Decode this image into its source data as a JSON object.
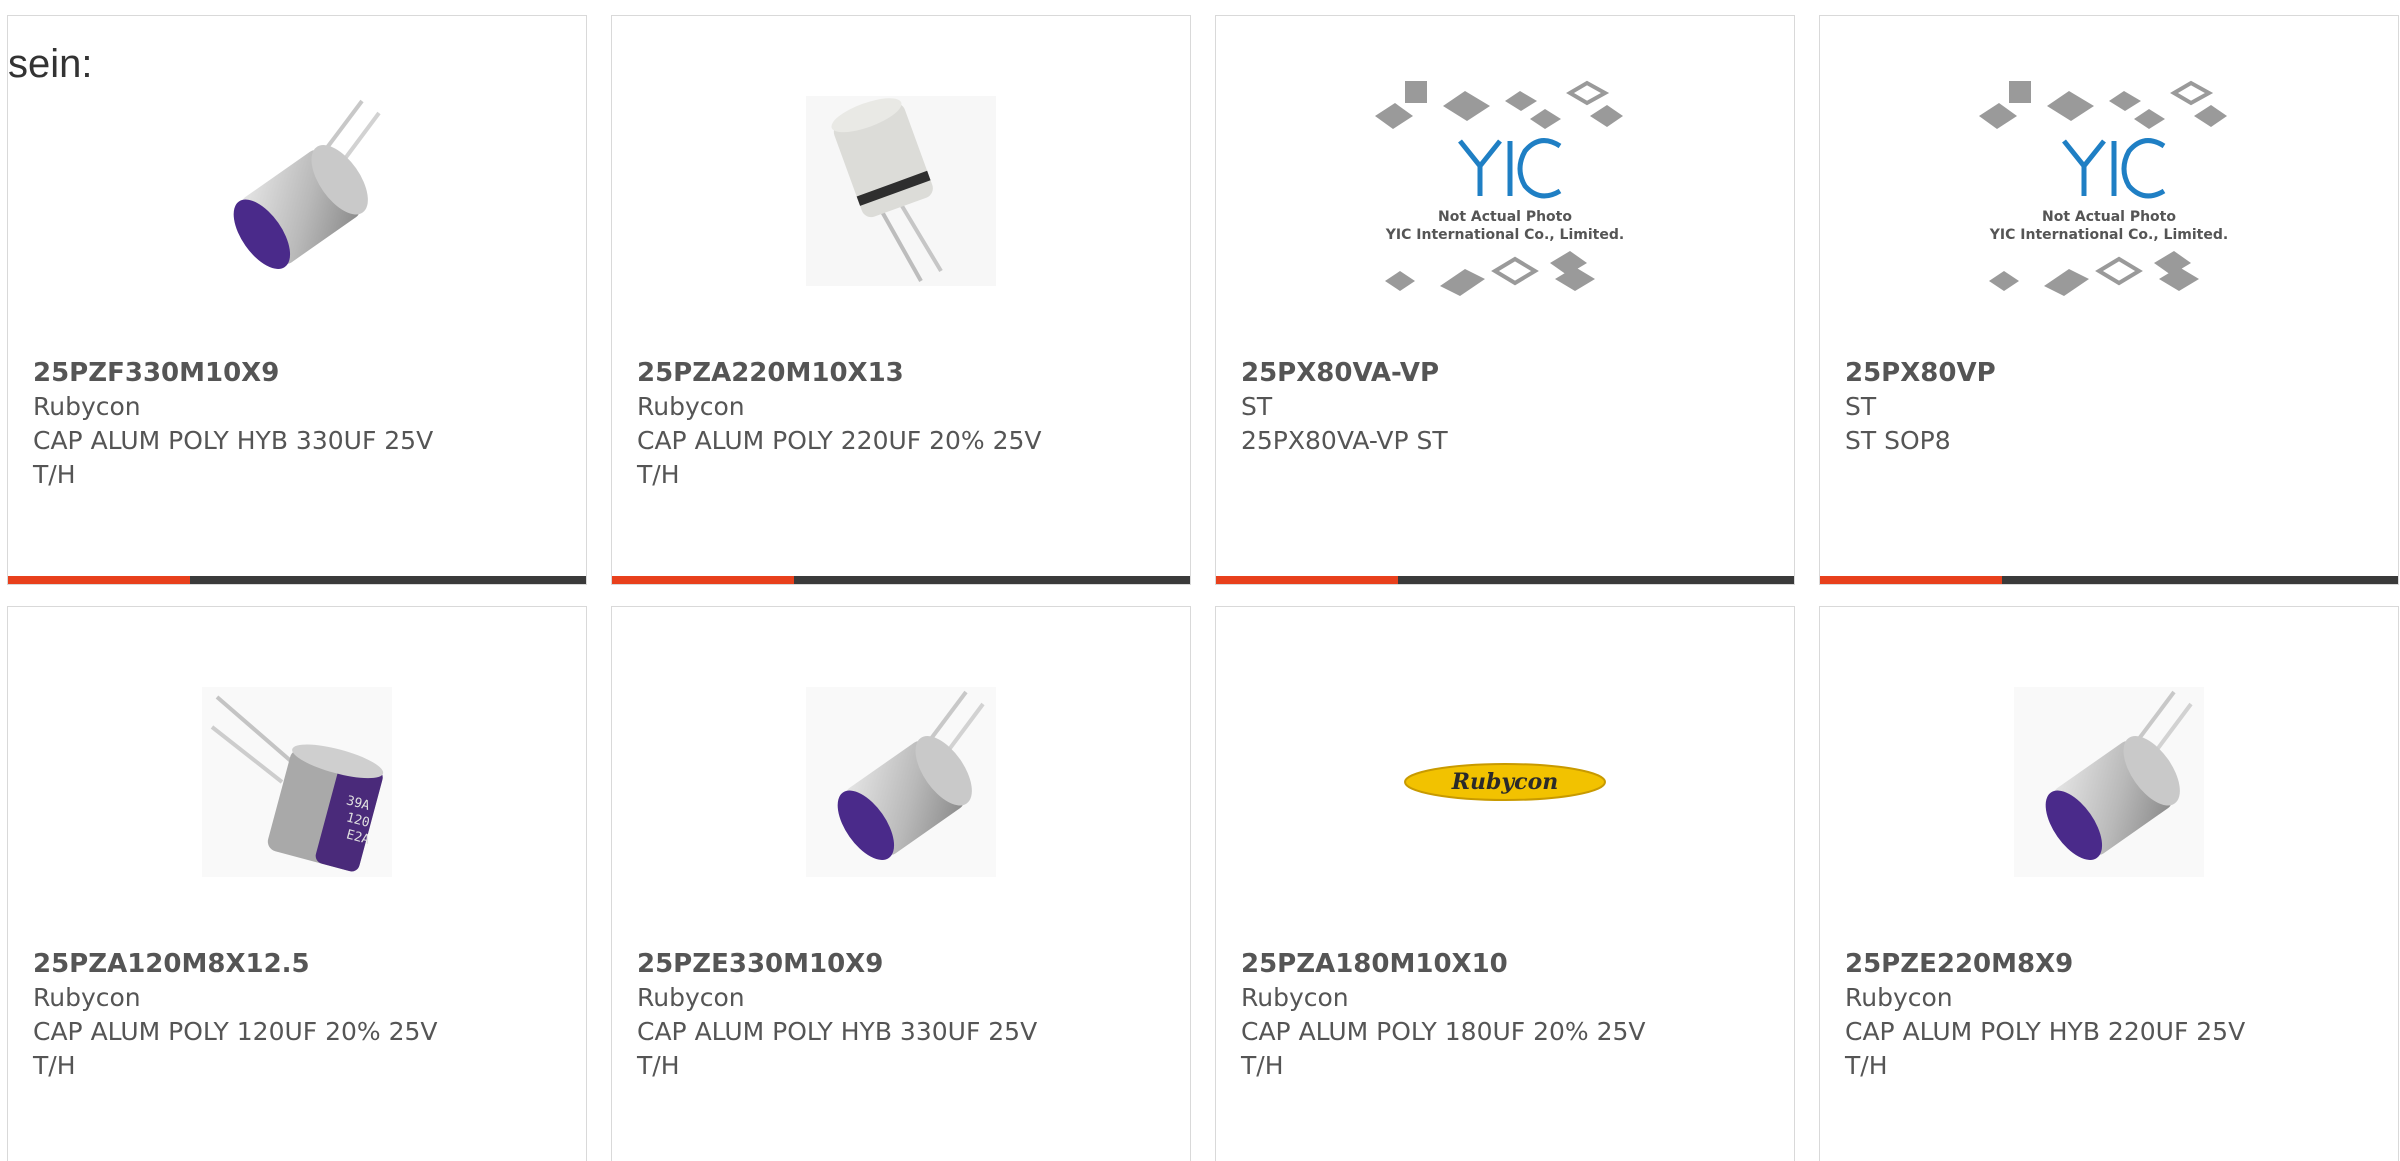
{
  "fragment_text": "sein:",
  "colors": {
    "accent": "#e8401c",
    "bar": "#3a3a3a",
    "text": "#555555",
    "border": "#d9d9d9"
  },
  "products": [
    {
      "part": "25PZF330M10X9",
      "maker": "Rubycon",
      "desc": "CAP ALUM POLY HYB 330UF 25V\nT/H",
      "image": "capacitor-purple-icon"
    },
    {
      "part": "25PZA220M10X13",
      "maker": "Rubycon",
      "desc": "CAP ALUM POLY 220UF 20% 25V\nT/H",
      "image": "capacitor-tall-icon"
    },
    {
      "part": "25PX80VA-VP",
      "maker": "ST",
      "desc": "25PX80VA-VP ST",
      "image": "yic-placeholder-icon",
      "placeholder_line1": "Not Actual Photo",
      "placeholder_line2": "YIC International Co., Limited."
    },
    {
      "part": "25PX80VP",
      "maker": "ST",
      "desc": "ST SOP8",
      "image": "yic-placeholder-icon",
      "placeholder_line1": "Not Actual Photo",
      "placeholder_line2": "YIC International Co., Limited."
    },
    {
      "part": "25PZA120M8X12.5",
      "maker": "Rubycon",
      "desc": "CAP ALUM POLY 120UF 20% 25V\nT/H",
      "image": "capacitor-marked-icon",
      "marking": [
        "39A",
        "120",
        "E2A"
      ]
    },
    {
      "part": "25PZE330M10X9",
      "maker": "Rubycon",
      "desc": "CAP ALUM POLY HYB 330UF 25V\nT/H",
      "image": "capacitor-purple-icon"
    },
    {
      "part": "25PZA180M10X10",
      "maker": "Rubycon",
      "desc": "CAP ALUM POLY 180UF 20% 25V\nT/H",
      "image": "rubycon-logo-icon",
      "logo_text": "Rubycon"
    },
    {
      "part": "25PZE220M8X9",
      "maker": "Rubycon",
      "desc": "CAP ALUM POLY HYB 220UF 25V\nT/H",
      "image": "capacitor-purple-icon"
    }
  ]
}
